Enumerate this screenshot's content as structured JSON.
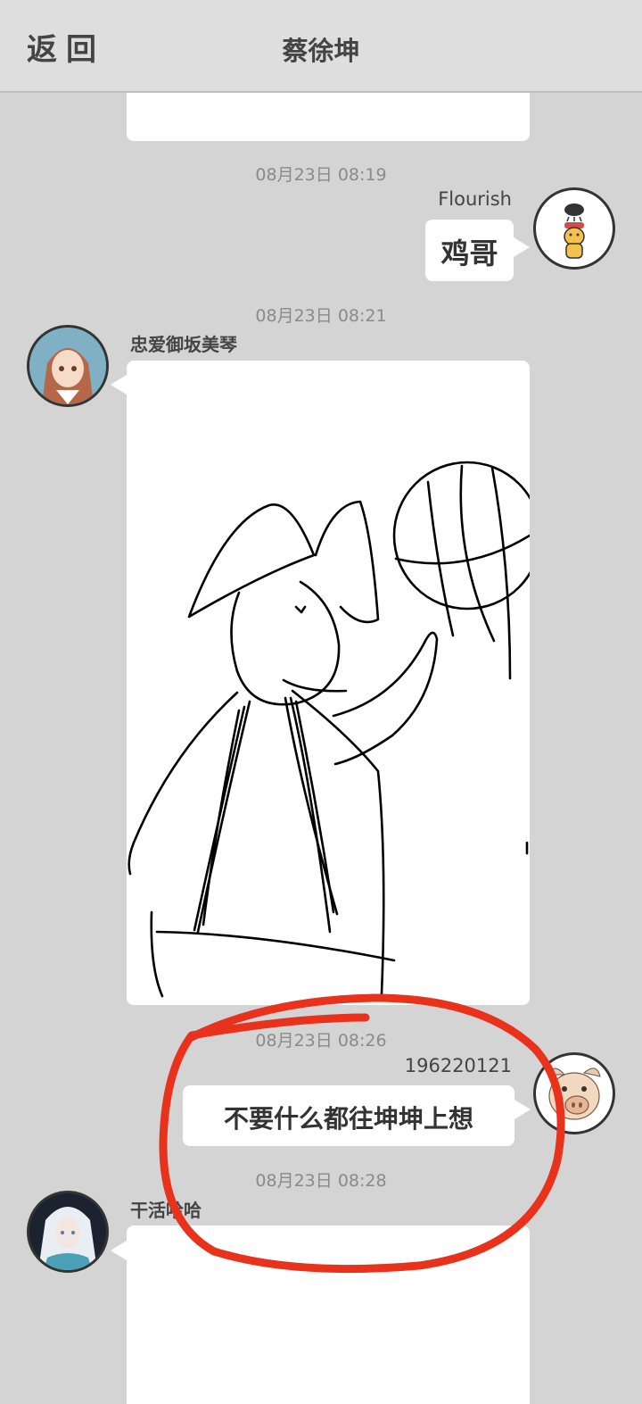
{
  "header": {
    "back_label": "返回",
    "title": "蔡徐坤"
  },
  "messages": [
    {
      "time": "08月23日  08:19",
      "sender": "Flourish",
      "text": "鸡哥"
    },
    {
      "time": "08月23日  08:21",
      "sender": "忠爱御坂美琴",
      "content": "drawing"
    },
    {
      "time": "08月23日  08:26",
      "sender": "196220121",
      "text": "不要什么都往坤坤上想"
    },
    {
      "time": "08月23日  08:28",
      "sender": "干活哈哈"
    }
  ],
  "colors": {
    "background": "#d4d4d4",
    "header": "#dedede",
    "bubble": "#ffffff",
    "annotation": "#e8321c"
  }
}
